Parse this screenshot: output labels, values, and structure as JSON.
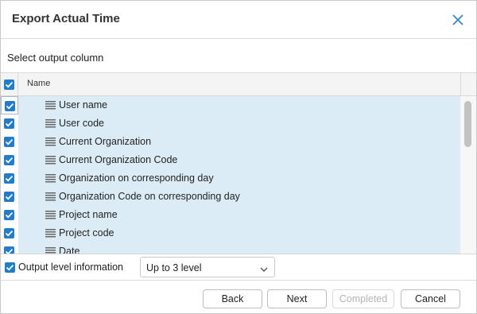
{
  "dialog": {
    "title": "Export Actual Time",
    "subtitle": "Select output column"
  },
  "grid": {
    "header_name": "Name",
    "all_checked": true,
    "rows": [
      {
        "label": "User name",
        "checked": true
      },
      {
        "label": "User code",
        "checked": true
      },
      {
        "label": "Current Organization",
        "checked": true
      },
      {
        "label": "Current Organization Code",
        "checked": true
      },
      {
        "label": "Organization on corresponding day",
        "checked": true
      },
      {
        "label": "Organization Code on corresponding day",
        "checked": true
      },
      {
        "label": "Project name",
        "checked": true
      },
      {
        "label": "Project code",
        "checked": true
      },
      {
        "label": "Date",
        "checked": true
      }
    ]
  },
  "level": {
    "label": "Output level information",
    "checked": true,
    "selected": "Up to 3 level"
  },
  "buttons": {
    "back": "Back",
    "next": "Next",
    "completed": "Completed",
    "cancel": "Cancel"
  },
  "icons": {
    "close": "close-icon",
    "drag": "drag-handle-icon",
    "checkbox": "checkbox-checked-icon",
    "chevron": "chevron-down-icon"
  },
  "colors": {
    "accent": "#1f7ccf",
    "row_selected": "#dcecf6",
    "close_icon": "#2b88c8"
  }
}
